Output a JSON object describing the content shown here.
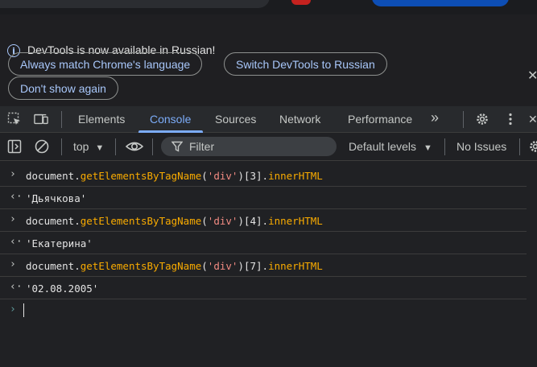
{
  "infobar": {
    "message": "DevTools is now available in Russian!",
    "buttons": [
      "Always match Chrome's language",
      "Switch DevTools to Russian",
      "Don't show again"
    ],
    "close_glyph": "✕"
  },
  "tabs": {
    "items": [
      "Elements",
      "Console",
      "Sources",
      "Network",
      "Performance"
    ],
    "active": "Console",
    "more_glyph": "»"
  },
  "filterbar": {
    "context": "top",
    "filter_placeholder": "Filter",
    "levels": "Default levels",
    "issues": "No Issues"
  },
  "console": {
    "entries": [
      {
        "type": "input",
        "obj": "document",
        "method": "getElementsByTagName",
        "arg": "'div'",
        "index": "[3]",
        "prop": "innerHTML"
      },
      {
        "type": "output",
        "value": "'Дьячкова'"
      },
      {
        "type": "input",
        "obj": "document",
        "method": "getElementsByTagName",
        "arg": "'div'",
        "index": "[4]",
        "prop": "innerHTML"
      },
      {
        "type": "output",
        "value": "'Екатерина'"
      },
      {
        "type": "input",
        "obj": "document",
        "method": "getElementsByTagName",
        "arg": "'div'",
        "index": "[7]",
        "prop": "innerHTML"
      },
      {
        "type": "output",
        "value": "'02.08.2005'"
      }
    ]
  },
  "colors": {
    "accent": "#7cacf8",
    "background": "#202124",
    "string": "#f28b82",
    "method": "#f9ab00",
    "result": "#7cc8f8"
  }
}
